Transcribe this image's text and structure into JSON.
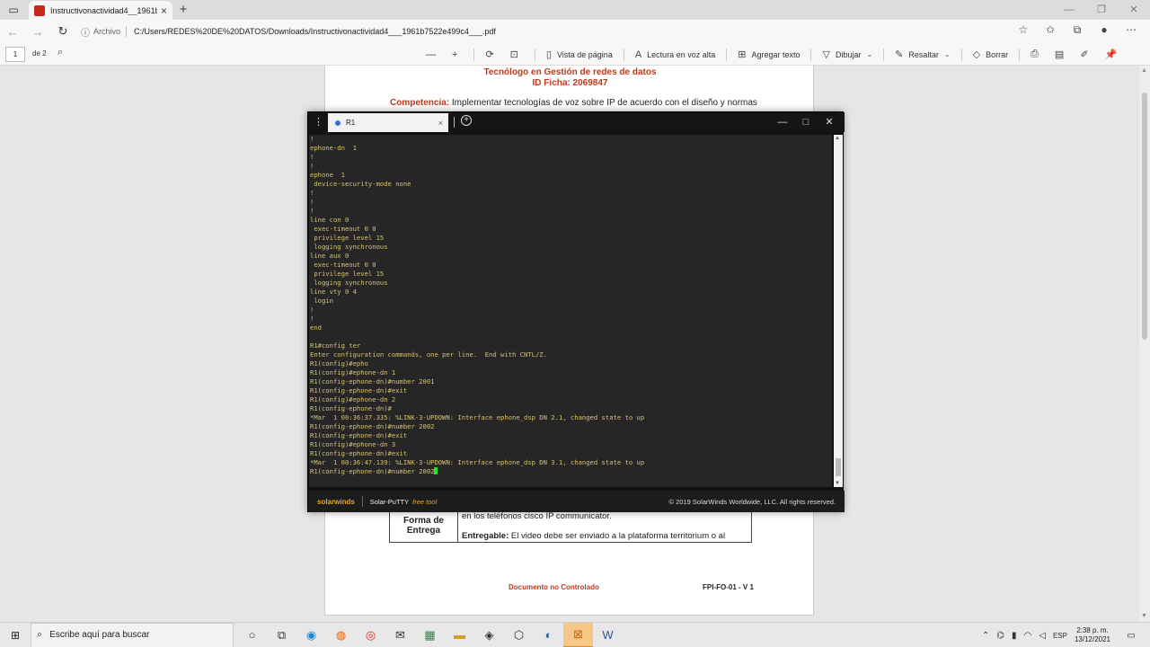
{
  "browser": {
    "tab_title": "Instructivonactividad4__1961b7",
    "address_label": "Archivo",
    "url": "C:/Users/REDES%20DE%20DATOS/Downloads/Instructivonactividad4___1961b7522e499c4___.pdf"
  },
  "pdf_toolbar": {
    "page_number": "1",
    "page_total": "de 2",
    "page_view": "Vista de página",
    "read_aloud": "Lectura en voz alta",
    "add_text": "Agregar texto",
    "draw": "Dibujar",
    "highlight": "Resaltar",
    "erase": "Borrar"
  },
  "document": {
    "title_line1": "Tecnólogo en Gestión de redes de datos",
    "title_line2": "ID Ficha: 2069847",
    "competencia_label": "Competencia:",
    "competencia_text": "Implementar tecnologías de voz sobre IP de acuerdo con el diseño y normas",
    "table_label": "Forma de Entrega",
    "table_line1": "en los teléfonos cisco IP communicator.",
    "table_line2_label": "Entregable:",
    "table_line2_text": "El video debe ser enviado a la plataforma territorium o al",
    "footer_left": "Documento no Controlado",
    "footer_right": "FPI-FO-01 - V 1"
  },
  "putty": {
    "tab_label": "R1",
    "brand": "solarwinds",
    "product": "Solar-PuTTY",
    "product_tag": "free tool",
    "copyright": "© 2019 SolarWinds Worldwide, LLC. All rights reserved.",
    "terminal_lines": [
      "!",
      "ephone-dn  1",
      "!",
      "!",
      "ephone  1",
      " device-security-mode none",
      "!",
      "!",
      "!",
      "line con 0",
      " exec-timeout 0 0",
      " privilege level 15",
      " logging synchronous",
      "line aux 0",
      " exec-timeout 0 0",
      " privilege level 15",
      " logging synchronous",
      "line vty 0 4",
      " login",
      "!",
      "!",
      "end",
      "",
      "R1#config ter",
      "Enter configuration commands, one per line.  End with CNTL/Z.",
      "R1(config)#epho",
      "R1(config)#ephone-dn 1",
      "R1(config-ephone-dn)#number 2001",
      "R1(config-ephone-dn)#exit",
      "R1(config)#ephone-dn 2",
      "R1(config-ephone-dn)#",
      "*Mar  1 00:36:37.335: %LINK-3-UPDOWN: Interface ephone_dsp DN 2.1, changed state to up",
      "R1(config-ephone-dn)#number 2002",
      "R1(config-ephone-dn)#exit",
      "R1(config)#ephone-dn 3",
      "R1(config-ephone-dn)#exit",
      "*Mar  1 00:36:47.139: %LINK-3-UPDOWN: Interface ephone_dsp DN 3.1, changed state to up"
    ],
    "prompt_line": "R1(config-ephone-dn)#number 2002"
  },
  "taskbar": {
    "search_placeholder": "Escribe aquí para buscar",
    "language": "ESP",
    "time": "2:38 p. m.",
    "date": "13/12/2021"
  },
  "colors": {
    "terminal_text": "#d8c272",
    "terminal_bg": "#262626",
    "cursor": "#28e02e",
    "document_accent": "#c0391b"
  }
}
